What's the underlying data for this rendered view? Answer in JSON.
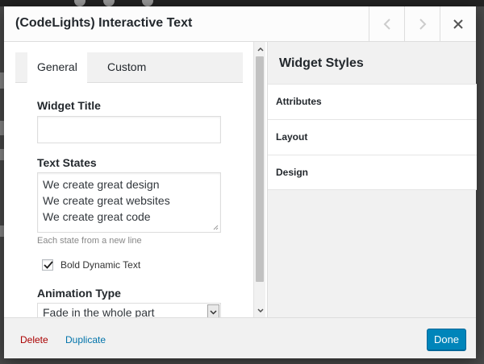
{
  "dialog": {
    "title": "(CodeLights) Interactive Text"
  },
  "tabs": [
    {
      "label": "General"
    },
    {
      "label": "Custom"
    }
  ],
  "form": {
    "widget_title_label": "Widget Title",
    "widget_title_value": "",
    "text_states_label": "Text States",
    "text_states_lines": [
      "We create great design",
      "We create great websites",
      "We create great code"
    ],
    "text_states_hint": "Each state from a new line",
    "bold_dynamic_label": "Bold Dynamic Text",
    "bold_dynamic_checked": true,
    "animation_type_label": "Animation Type",
    "animation_type_value": "Fade in the whole part"
  },
  "styles_panel": {
    "title": "Widget Styles",
    "sections": [
      {
        "label": "Attributes"
      },
      {
        "label": "Layout"
      },
      {
        "label": "Design"
      }
    ]
  },
  "footer": {
    "delete_label": "Delete",
    "duplicate_label": "Duplicate",
    "done_label": "Done"
  },
  "colors": {
    "primary_button": "#0085ba",
    "delete_link": "#aa0000",
    "duplicate_link": "#0073aa"
  }
}
